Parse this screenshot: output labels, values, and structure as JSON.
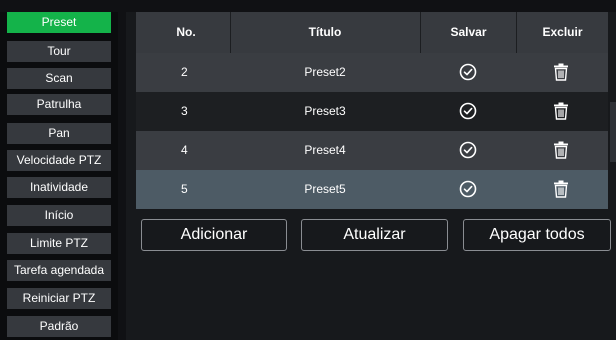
{
  "sidebar": {
    "items": [
      {
        "label": "Preset",
        "active": true
      },
      {
        "label": "Tour"
      },
      {
        "label": "Scan"
      },
      {
        "label": "Patrulha"
      },
      {
        "label": "Pan"
      },
      {
        "label": "Velocidade PTZ"
      },
      {
        "label": "Inatividade"
      },
      {
        "label": "Início"
      },
      {
        "label": "Limite PTZ"
      },
      {
        "label": "Tarefa agendada"
      },
      {
        "label": "Reiniciar PTZ"
      },
      {
        "label": "Padrão"
      }
    ]
  },
  "table": {
    "headers": {
      "no": "No.",
      "title": "Título",
      "save": "Salvar",
      "delete": "Excluir"
    },
    "rows": [
      {
        "no": "2",
        "title": "Preset2",
        "save_icon": "check-circle-icon",
        "delete_icon": "trash-icon"
      },
      {
        "no": "3",
        "title": "Preset3",
        "save_icon": "check-circle-icon",
        "delete_icon": "trash-icon"
      },
      {
        "no": "4",
        "title": "Preset4",
        "save_icon": "check-circle-icon",
        "delete_icon": "trash-icon"
      },
      {
        "no": "5",
        "title": "Preset5",
        "save_icon": "check-circle-icon",
        "delete_icon": "trash-icon",
        "selected": true
      }
    ]
  },
  "actions": {
    "add": "Adicionar",
    "refresh": "Atualizar",
    "delete_all": "Apagar todos"
  },
  "colors": {
    "accent": "#14b34a",
    "row_selected": "#4d5b65",
    "row_alt": "#3a3d42",
    "row_dark": "#1d1f22"
  }
}
